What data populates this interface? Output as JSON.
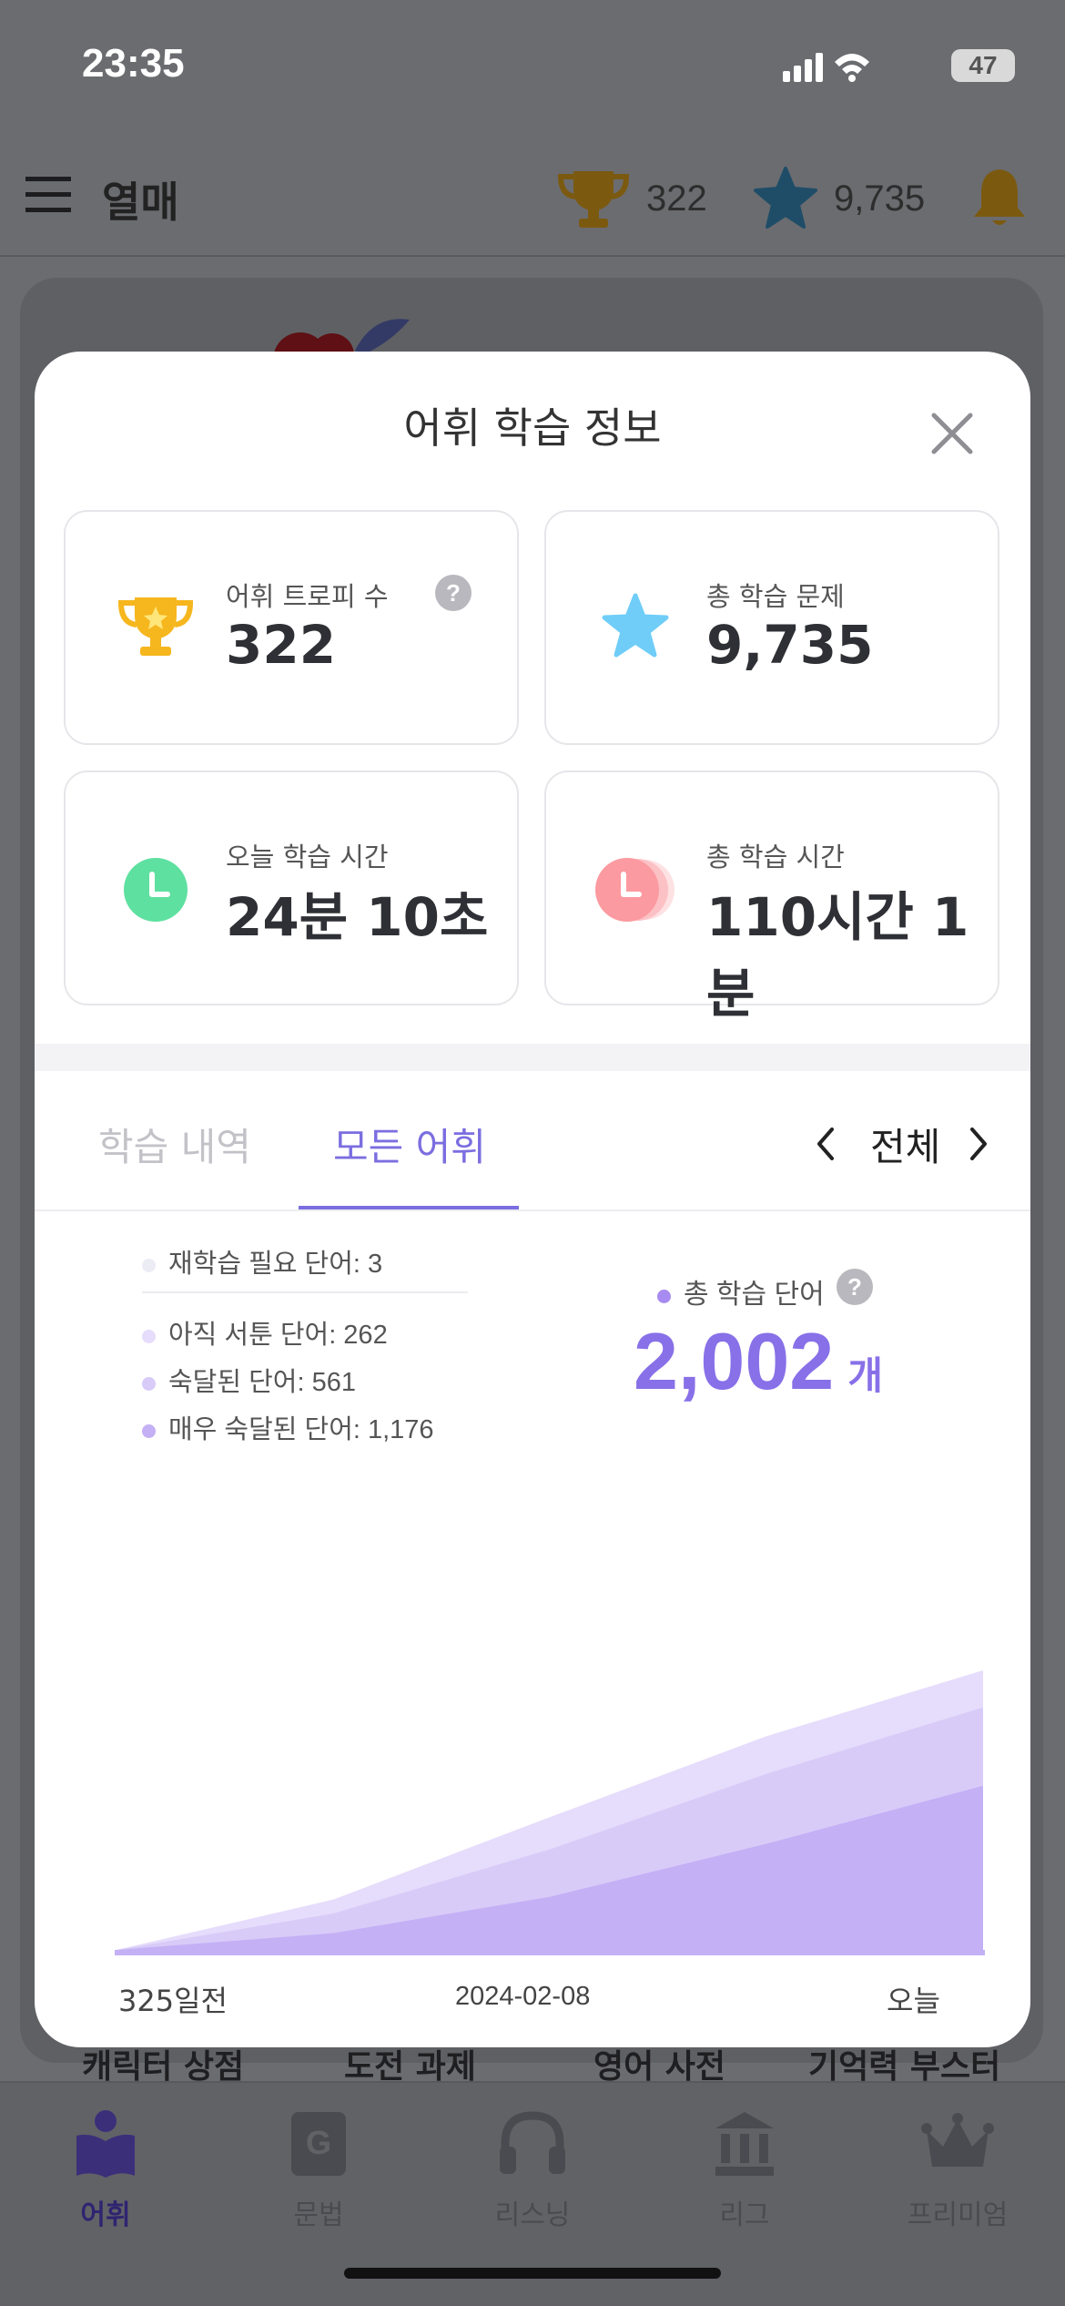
{
  "status_bar": {
    "time": "23:35",
    "battery": "47"
  },
  "header": {
    "title": "열매",
    "trophy_count": "322",
    "star_count": "9,735"
  },
  "quick_links": [
    "캐릭터 상점",
    "도전 과제",
    "영어 사전",
    "기억력 부스터"
  ],
  "bottom_nav": [
    {
      "label": "어휘",
      "icon": "book-icon",
      "active": true
    },
    {
      "label": "문법",
      "icon": "grammar-book-icon",
      "active": false
    },
    {
      "label": "리스닝",
      "icon": "headphones-icon",
      "active": false
    },
    {
      "label": "리그",
      "icon": "league-building-icon",
      "active": false
    },
    {
      "label": "프리미엄",
      "icon": "crown-icon",
      "active": false
    }
  ],
  "modal": {
    "title": "어휘 학습 정보",
    "stats": {
      "trophy_label": "어휘 트로피 수",
      "trophy_value": "322",
      "questions_label": "총 학습 문제",
      "questions_value": "9,735",
      "today_time_label": "오늘 학습 시간",
      "today_time_value": "24분 10초",
      "total_time_label": "총 학습 시간",
      "total_time_value": "110시간 1분"
    },
    "tabs": {
      "history": "학습 내역",
      "all_words": "모든 어휘",
      "active": "all_words"
    },
    "range": {
      "label": "전체"
    },
    "legend": {
      "relearn": "재학습 필요 단어: 3",
      "unfamiliar": "아직 서툰 단어: 262",
      "mastered": "숙달된 단어: 561",
      "very_mastered": "매우 숙달된 단어: 1,176"
    },
    "total": {
      "label": "총 학습 단어",
      "value": "2,002",
      "unit": "개"
    }
  },
  "colors": {
    "accent": "#7b6ee0",
    "trophy": "#f6b61e",
    "star": "#6fcdf8",
    "clock_today": "#5ee0a0",
    "clock_total": "#fb9aa0"
  },
  "chart_data": {
    "type": "area",
    "x_tick_labels": [
      "325일전",
      "2024-02-08",
      "오늘"
    ],
    "x": [
      0,
      0.25,
      0.5,
      0.75,
      1
    ],
    "series": [
      {
        "name": "매우 숙달된 단어",
        "values": [
          0,
          120,
          380,
          760,
          1176
        ],
        "color": "#c4b0f5"
      },
      {
        "name": "숙달된 단어",
        "values": [
          0,
          260,
          720,
          1260,
          1737
        ],
        "color": "#d8cbf8"
      },
      {
        "name": "아직 서툰 단어",
        "values": [
          0,
          360,
          950,
          1530,
          2002
        ],
        "color": "#e6dcfb"
      }
    ],
    "ylim": [
      0,
      3000
    ],
    "grid": false
  }
}
